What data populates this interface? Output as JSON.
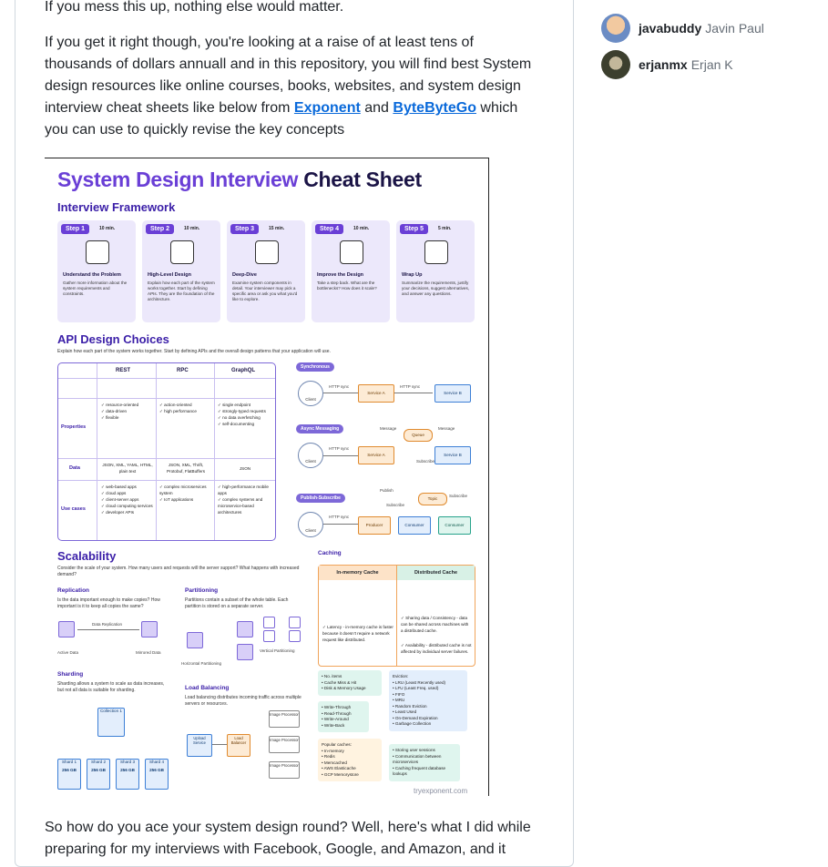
{
  "article": {
    "line_top": "If you mess this up, nothing else would matter.",
    "para2_text1": "If you get it right though, you're looking at a raise of at least tens of thousands of dollars annuall and in this repository, you will find best System design resources like online courses, books, websites, and system design interview cheat sheets like below from ",
    "link_exponent": "Exponent",
    "para2_and": " and ",
    "link_bytebytego": "ByteByteGo",
    "para2_text2": " which you can use to quickly revise the key concepts",
    "para3": "So how do you ace your system design round? Well, here's what I did while preparing for my interviews with Facebook, Google, and Amazon, and it"
  },
  "contributors": [
    {
      "login": "javabuddy",
      "name": "Javin Paul"
    },
    {
      "login": "erjanmx",
      "name": "Erjan K"
    }
  ],
  "sheet": {
    "title_a": "System Design Interview",
    "title_b": "Cheat Sheet",
    "framework_title": "Interview Framework",
    "steps": [
      {
        "badge": "Step 1",
        "time": "10 min.",
        "title": "Understand the Problem",
        "desc": "Gather more information about the system requirements and constraints."
      },
      {
        "badge": "Step 2",
        "time": "10 min.",
        "title": "High-Level Design",
        "desc": "Explain how each part of the system works together. Start by defining APIs. They are the foundation of the architecture."
      },
      {
        "badge": "Step 3",
        "time": "15 min.",
        "title": "Deep-Dive",
        "desc": "Examine system components in detail. Your interviewer may pick a specific area or ask you what you'd like to explore."
      },
      {
        "badge": "Step 4",
        "time": "10 min.",
        "title": "Improve the Design",
        "desc": "Take a step back. What are the bottlenecks? How does it scale?"
      },
      {
        "badge": "Step 5",
        "time": "5 min.",
        "title": "Wrap Up",
        "desc": "Summarize the requirements, justify your decisions, suggest alternatives, and answer any questions."
      }
    ],
    "api_title": "API Design Choices",
    "api_sub": "Explain how each part of the system works together. Start by defining APIs and the overall design patterns that your application will use.",
    "api_cols": [
      "REST",
      "RPC",
      "GraphQL"
    ],
    "api_rows": [
      "Properties",
      "Data",
      "Use cases"
    ],
    "props": [
      "✓ resource-oriented\n✓ data-driven\n✓ flexible",
      "✓ action-oriented\n✓ high performance",
      "✓ single endpoint\n✓ strongly-typed requests\n✓ no data overfetching\n✓ self-documenting"
    ],
    "data_cells": [
      "JSON, XML, YAML, HTML, plain text",
      "JSON, XML, Thrift, Protobuf, FlatBuffers",
      "JSON"
    ],
    "uses": [
      "✓ web-based apps\n✓ cloud apps\n✓ client-server apps\n✓ cloud computing services\n✓ developer APIs",
      "✓ complex microservices system\n✓ IoT applications",
      "✓ high-performance mobile apps\n✓ complex systems and microservice-based architectures"
    ],
    "patterns": [
      "Synchronous",
      "Async Messaging",
      "Publish-Subscribe"
    ],
    "nodes": {
      "client": "Client",
      "svc_a": "Service A",
      "svc_b": "Service B",
      "queue": "Queue",
      "topic": "Topic",
      "producer": "Producer",
      "consumer": "Consumer",
      "http_sync": "HTTP sync",
      "message": "Message",
      "subscribe": "Subscribe",
      "publish": "Publish"
    },
    "scal_title": "Scalability",
    "scal_sub": "Consider the scale of your system. How many users and requests will the server support? What happens with increased demand?",
    "replication": "Replication",
    "replication_sub": "Is the data important enough to make copies? How important is it to keep all copies the same?",
    "data_replication": "Data Replication",
    "active_data": "Active Data",
    "mirrored_data": "Mirrored Data",
    "partitioning": "Partitioning",
    "partitioning_sub": "Partitions contain a subset of the whole table. Each partition is stored on a separate server.",
    "horiz_part": "Horizontal Partitioning",
    "vert_part": "Vertical Partitioning",
    "sharding": "Sharding",
    "sharding_sub": "Sharding allows a system to scale as data increases, but not all data is suitable for sharding.",
    "collection": "Collection 1",
    "shards": [
      "Shard 1",
      "Shard 2",
      "Shard 3",
      "Shard 4"
    ],
    "shard_size": "256 GB",
    "lb": "Load Balancing",
    "lb_sub": "Load balancing distributes incoming traffic across multiple servers or resources.",
    "upload_service": "Upload Service",
    "load_balancer": "Load Balancer",
    "image_processor": "Image Processor",
    "caching": "Caching",
    "inmem": "In-memory Cache",
    "distcache": "Distributed Cache",
    "latency": "✓ Latency - in-memory cache is faster because it doesn't require a network request like distributed.",
    "sharing": "✓ Sharing data / Consistency - data can be shared across machines with a distributed cache.",
    "availability": "✓ Availability - distributed cache is not affected by individual server failures.",
    "items_list": "• No. items\n• Cache Miss & Hit\n• Disk & Memory Usage",
    "writes_list": "• Write-Through\n• Read-Through\n• Write-Around\n• Write-Back",
    "eviction": "Eviction:\n• LRU (Least Recently used)\n• LFU (Least Freq. used)\n• FIFO\n• MRU\n• Random Eviction\n• Least Used\n• On-Demand Expiration\n• Garbage Collection",
    "popular": "Popular caches:\n• In-memory\n• Redis\n• Memcached\n• AWS Elasticache\n• GCP Memorystore",
    "uses_cache": "• Storing user sessions\n• Communication between microservices\n• Caching frequent database lookups",
    "footer": "tryexponent.com"
  },
  "colors": {
    "link": "#0969da",
    "accent": "#6a3fd6",
    "border": "#d0d7de"
  }
}
